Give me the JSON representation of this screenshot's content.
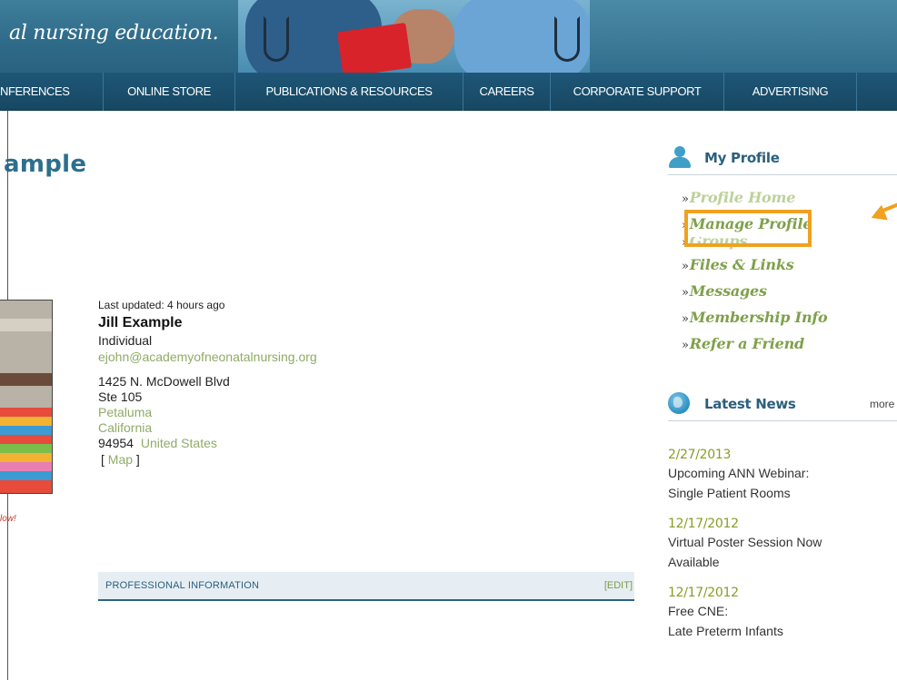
{
  "header": {
    "tagline": "al nursing education."
  },
  "nav": {
    "items": [
      "NFERENCES",
      "ONLINE STORE",
      "PUBLICATIONS & RESOURCES",
      "CAREERS",
      "CORPORATE SUPPORT",
      "ADVERTISING"
    ]
  },
  "page": {
    "title": "ample"
  },
  "profile": {
    "last_updated": "Last updated: 4 hours ago",
    "name": "Jill Example",
    "member_type": "Individual",
    "email": "ejohn@academyofneonatalnursing.org",
    "address_line1": "1425 N. McDowell Blvd",
    "address_line2": "Ste 105",
    "city": "Petaluma",
    "state": "California",
    "zip": "94954",
    "country": "United States",
    "map_open": "[",
    "map_label": "Map",
    "map_close": "]",
    "avatar_caption": "low!"
  },
  "professional": {
    "section_label": "PROFESSIONAL INFORMATION",
    "edit_label": "[EDIT]"
  },
  "sidebar": {
    "my_profile_title": "My Profile",
    "menu": [
      "Profile Home",
      "Manage Profile",
      "Groups",
      "Files & Links",
      "Messages",
      "Membership Info",
      "Refer a Friend"
    ],
    "latest_news_title": "Latest News",
    "more_label": "more",
    "news": [
      {
        "date": "2/27/2013",
        "title1": "Upcoming ANN Webinar:",
        "title2": "Single Patient Rooms"
      },
      {
        "date": "12/17/2012",
        "title1": "Virtual Poster Session Now",
        "title2": "Available"
      },
      {
        "date": "12/17/2012",
        "title1": "Free CNE:",
        "title2": "Late Preterm Infants"
      }
    ]
  },
  "colors": {
    "nav_bg": "#1e5677",
    "title_blue": "#2d6f8c",
    "link_green": "#7fa04a",
    "highlight_orange": "#f0a11f"
  }
}
